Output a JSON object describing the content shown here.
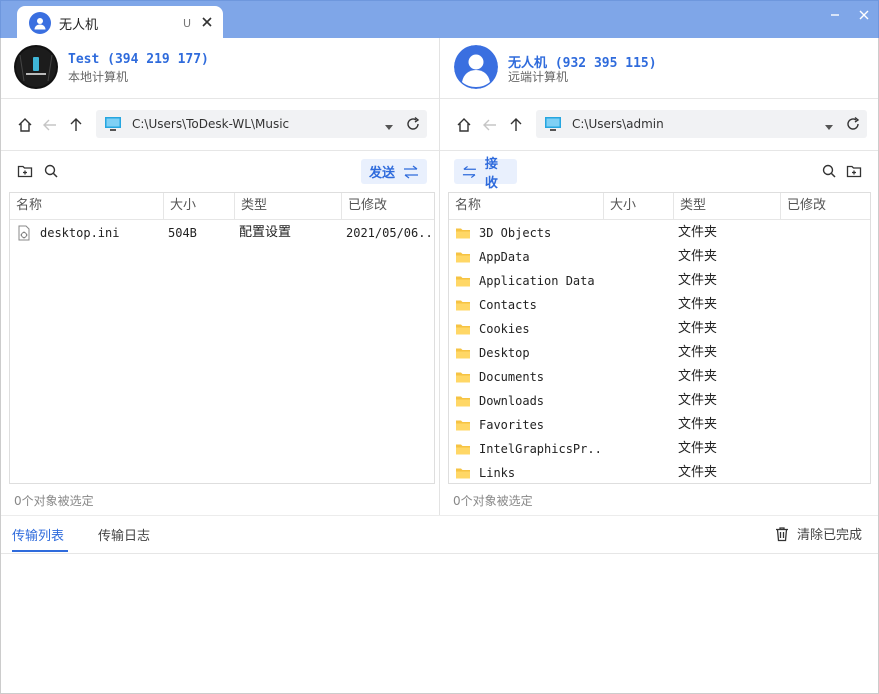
{
  "tab": {
    "title": "无人机",
    "u_label": "U"
  },
  "local": {
    "name": "Test (394 219 177)",
    "subtitle": "本地计算机",
    "path": "C:\\Users\\ToDesk-WL\\Music",
    "send_label": "发送",
    "columns": [
      "名称",
      "大小",
      "类型",
      "已修改"
    ],
    "files": [
      {
        "name": "desktop.ini",
        "size": "504B",
        "type": "配置设置",
        "modified": "2021/05/06...",
        "icon": "config-file-icon"
      }
    ],
    "status": "0个对象被选定"
  },
  "remote": {
    "name": "无人机 (932 395 115)",
    "subtitle": "远端计算机",
    "path": "C:\\Users\\admin",
    "receive_label": "接收",
    "columns": [
      "名称",
      "大小",
      "类型",
      "已修改"
    ],
    "files": [
      {
        "name": "3D Objects",
        "type": "文件夹",
        "icon": "folder-icon"
      },
      {
        "name": "AppData",
        "type": "文件夹",
        "icon": "folder-icon"
      },
      {
        "name": "Application Data",
        "type": "文件夹",
        "icon": "folder-icon"
      },
      {
        "name": "Contacts",
        "type": "文件夹",
        "icon": "folder-icon"
      },
      {
        "name": "Cookies",
        "type": "文件夹",
        "icon": "folder-icon"
      },
      {
        "name": "Desktop",
        "type": "文件夹",
        "icon": "folder-icon"
      },
      {
        "name": "Documents",
        "type": "文件夹",
        "icon": "folder-icon"
      },
      {
        "name": "Downloads",
        "type": "文件夹",
        "icon": "folder-icon"
      },
      {
        "name": "Favorites",
        "type": "文件夹",
        "icon": "folder-icon"
      },
      {
        "name": "IntelGraphicsPr...",
        "type": "文件夹",
        "icon": "folder-icon"
      },
      {
        "name": "Links",
        "type": "文件夹",
        "icon": "folder-icon"
      }
    ],
    "status": "0个对象被选定"
  },
  "transfer": {
    "tabs": [
      "传输列表",
      "传输日志"
    ],
    "active_tab": "传输列表",
    "clear_label": "清除已完成"
  },
  "colors": {
    "accent": "#2f6bdc",
    "titlebar": "#7fa6e8",
    "folder": "#f6c343"
  }
}
